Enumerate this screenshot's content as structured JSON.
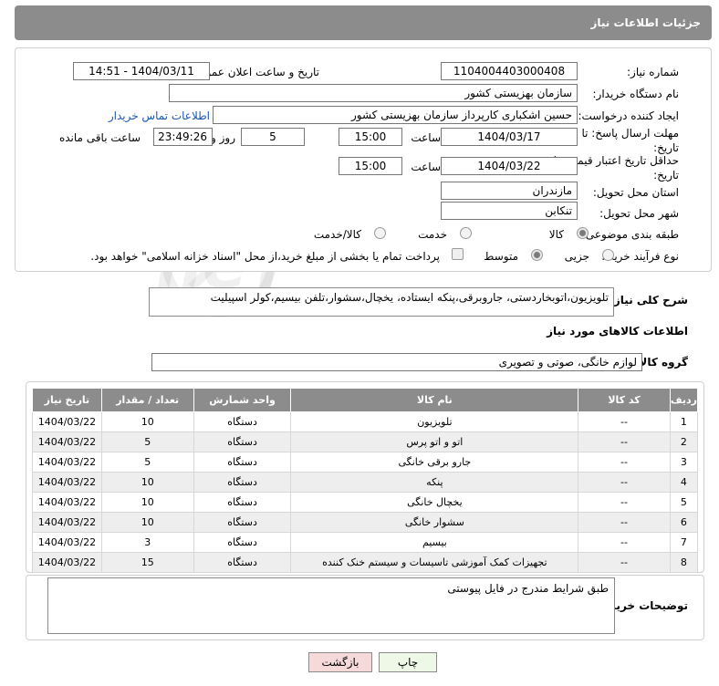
{
  "header": {
    "title": "جزئیات اطلاعات نیاز"
  },
  "form": {
    "need_number_label": "شماره نیاز:",
    "need_number": "1104004403000408",
    "announce_label": "تاریخ و ساعت اعلان عمومی:",
    "announce_value": "1404/03/11 - 14:51",
    "buyer_org_label": "نام دستگاه خریدار:",
    "buyer_org": "سازمان بهزیستی کشور",
    "creator_label": "ایجاد کننده درخواست:",
    "creator": "حسین اشکباری کارپرداز سازمان بهزیستی کشور",
    "contact_link": "اطلاعات تماس خریدار",
    "deadline_label": "مهلت ارسال پاسخ: تا تاریخ:",
    "deadline_date": "1404/03/17",
    "time_label": "ساعت",
    "deadline_time": "15:00",
    "days_value": "5",
    "days_label": "روز و",
    "remaining_value": "23:49:26",
    "remaining_label": "ساعت باقی مانده",
    "price_valid_label": "حداقل تاریخ اعتبار قیمت: تا تاریخ:",
    "price_valid_date": "1404/03/22",
    "price_valid_time": "15:00",
    "province_label": "استان محل تحویل:",
    "province": "مازندران",
    "city_label": "شهر محل تحویل:",
    "city": "تنکابن",
    "category_label": "طبقه بندی موضوعی:",
    "category_options": [
      "کالا",
      "خدمت",
      "کالا/خدمت"
    ],
    "process_label": "نوع فرآیند خرید :",
    "process_options": [
      "جزیی",
      "متوسط"
    ],
    "payment_note": "پرداخت تمام یا بخشی از مبلغ خرید،از محل \"اسناد خزانه اسلامی\" خواهد بود."
  },
  "description": {
    "label": "شرح کلی نیاز:",
    "text": "تلویزیون،اتوبخاردستی، جاروبرقی،پنکه ایستاده، یخچال،سشوار،تلفن بیسیم،کولر اسپیلیت"
  },
  "goods": {
    "section_title": "اطلاعات کالاهای مورد نیاز",
    "group_label": "گروه کالا:",
    "group_value": "لوازم خانگی، صوتی و تصویری",
    "columns": [
      "ردیف",
      "کد کالا",
      "نام کالا",
      "واحد شمارش",
      "تعداد / مقدار",
      "تاریخ نیاز"
    ],
    "rows": [
      [
        "1",
        "--",
        "تلویزیون",
        "دستگاه",
        "10",
        "1404/03/22"
      ],
      [
        "2",
        "--",
        "اتو و اتو پرس",
        "دستگاه",
        "5",
        "1404/03/22"
      ],
      [
        "3",
        "--",
        "جارو برقی خانگی",
        "دستگاه",
        "5",
        "1404/03/22"
      ],
      [
        "4",
        "--",
        "پنکه",
        "دستگاه",
        "10",
        "1404/03/22"
      ],
      [
        "5",
        "--",
        "یخچال خانگی",
        "دستگاه",
        "10",
        "1404/03/22"
      ],
      [
        "6",
        "--",
        "سشوار خانگی",
        "دستگاه",
        "10",
        "1404/03/22"
      ],
      [
        "7",
        "--",
        "بیسیم",
        "دستگاه",
        "3",
        "1404/03/22"
      ],
      [
        "8",
        "--",
        "تجهیزات کمک آموزشی تاسیسات و سیستم خنک کننده",
        "دستگاه",
        "15",
        "1404/03/22"
      ]
    ]
  },
  "buyer_notes": {
    "label": "توضیحات خریدار:",
    "text": "طبق شرایط مندرج در فایل پیوستی"
  },
  "buttons": {
    "print": "چاپ",
    "back": "بازگشت"
  },
  "colors": {
    "header_bg": "#8c8c8c",
    "link": "#1a56b0",
    "back_btn_bg": "#f6d9d9",
    "print_btn_bg": "#eef8e6"
  }
}
